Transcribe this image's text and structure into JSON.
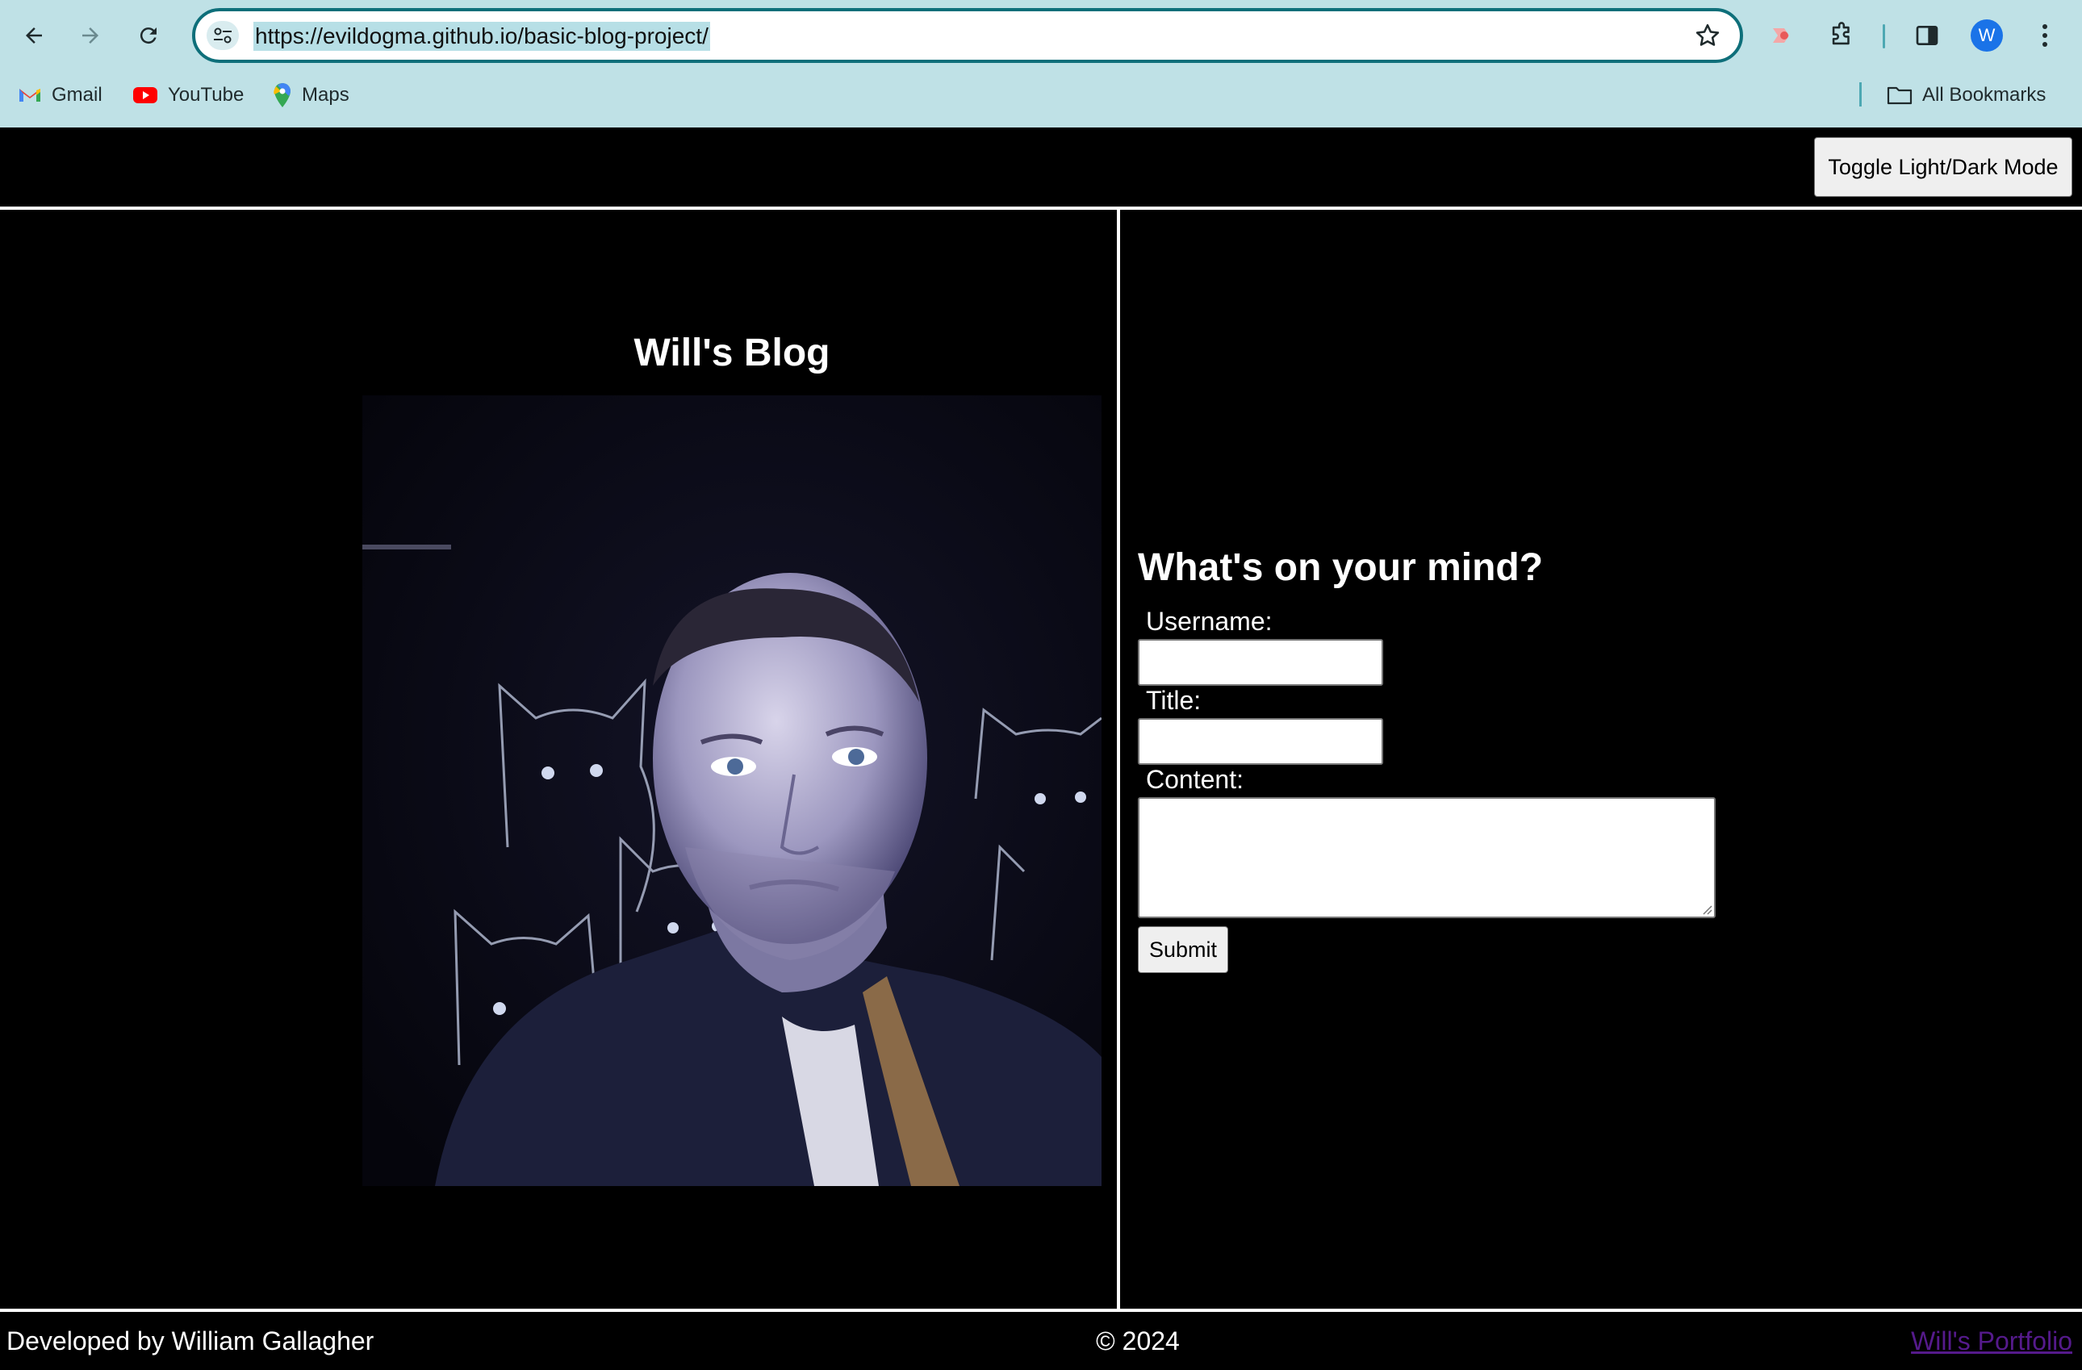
{
  "browser": {
    "url": "https://evildogma.github.io/basic-blog-project/",
    "profile_initial": "W",
    "bookmarks": [
      {
        "label": "Gmail",
        "icon": "gmail-icon"
      },
      {
        "label": "YouTube",
        "icon": "youtube-icon"
      },
      {
        "label": "Maps",
        "icon": "maps-icon"
      }
    ],
    "all_bookmarks": "All Bookmarks"
  },
  "page": {
    "toggle_label": "Toggle Light/Dark Mode",
    "blog_title": "Will's Blog",
    "form": {
      "heading": "What's on your mind?",
      "username_label": "Username:",
      "title_label": "Title:",
      "content_label": "Content:",
      "username_value": "",
      "title_value": "",
      "content_value": "",
      "submit_label": "Submit"
    },
    "footer": {
      "credit": "Developed by William Gallagher",
      "copyright": "© 2024",
      "portfolio_link": "Will's Portfolio"
    }
  },
  "colors": {
    "chrome_bg": "#bfe1e6",
    "page_bg": "#000000",
    "text": "#ffffff",
    "visited_link": "#551a8b"
  }
}
